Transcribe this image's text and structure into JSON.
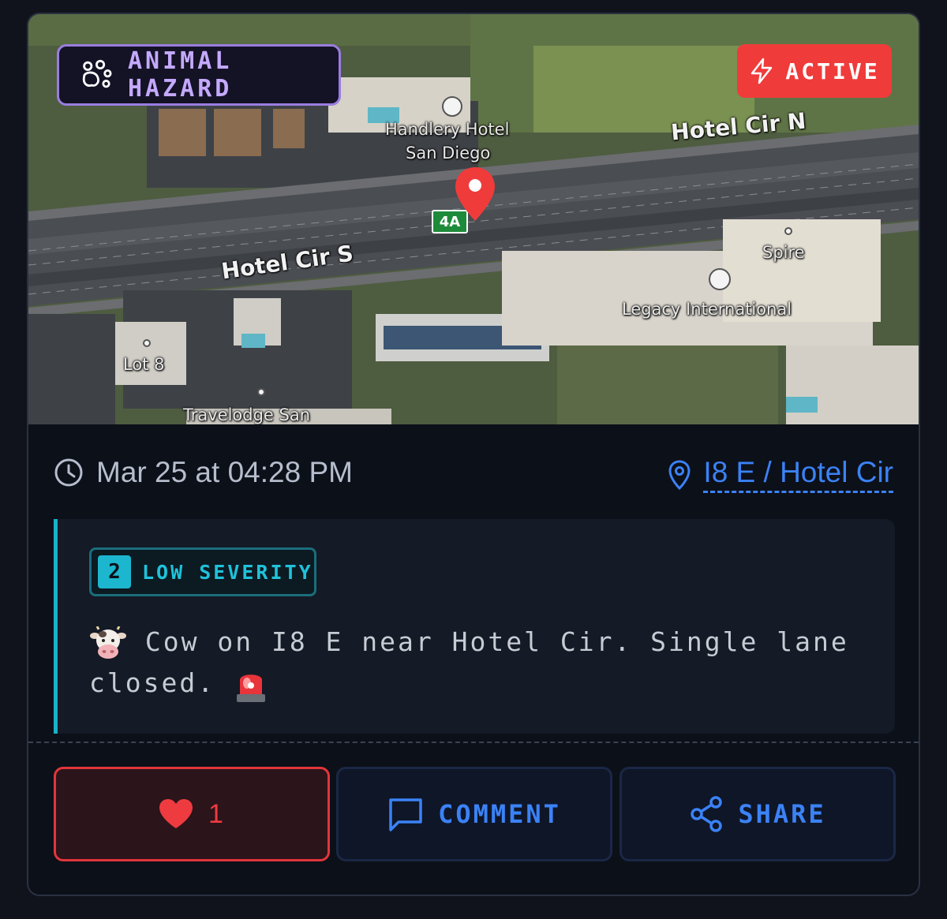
{
  "map": {
    "road_labels": [
      "Hotel Cir N",
      "Hotel Cir S"
    ],
    "poi_labels": [
      "Handlery Hotel",
      "San Diego",
      "Legacy International",
      "Spire",
      "Lot 8",
      "Travelodge San"
    ],
    "exit_sign": "4A",
    "pin_color": "#f03b3b"
  },
  "incident": {
    "type_label": "ANIMAL HAZARD",
    "type_icon": "paw-icon",
    "status_label": "ACTIVE",
    "status_icon": "lightning-icon",
    "time": "Mar 25 at 04:28 PM",
    "location": "I8 E / Hotel Cir",
    "severity_number": "2",
    "severity_label": "LOW SEVERITY",
    "description_line1": "Cow on I8 E near Hotel Cir. Single lane",
    "description_line2": "closed.",
    "description_emojis": [
      "cow-face-emoji",
      "police-light-emoji"
    ]
  },
  "actions": {
    "like_count": "1",
    "comment_label": "COMMENT",
    "share_label": "SHARE"
  },
  "colors": {
    "accent_purple": "#9a7de0",
    "active_red": "#f03b3b",
    "link_blue": "#3b82f6",
    "severity_cyan": "#1cb6cf"
  }
}
